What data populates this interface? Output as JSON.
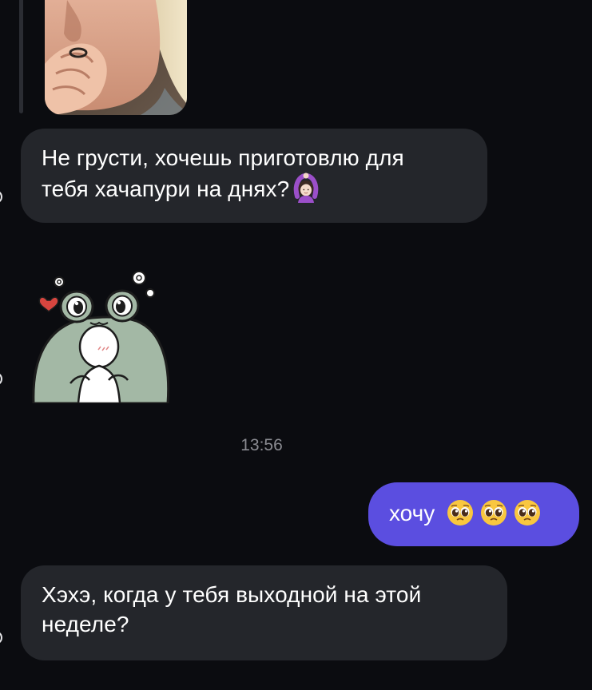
{
  "messages": {
    "incoming_1": {
      "line1": "Не грусти, хочешь приготовлю для",
      "line2": "тебя хачапури на днях?",
      "emoji": "woman-gesturing-ok-emoji"
    },
    "timestamp": "13:56",
    "outgoing_1": {
      "text": "хочу",
      "emojis": [
        "pleading-face-emoji",
        "pleading-face-emoji",
        "pleading-face-emoji"
      ]
    },
    "incoming_2": {
      "line1": "Хэхэ, когда у тебя выходной на этой",
      "line2": "неделе?"
    }
  },
  "colors": {
    "background": "#0b0c10",
    "incoming_bubble": "#24262b",
    "outgoing_bubble": "#5b4ee0",
    "timestamp_text": "#8a8b91"
  }
}
